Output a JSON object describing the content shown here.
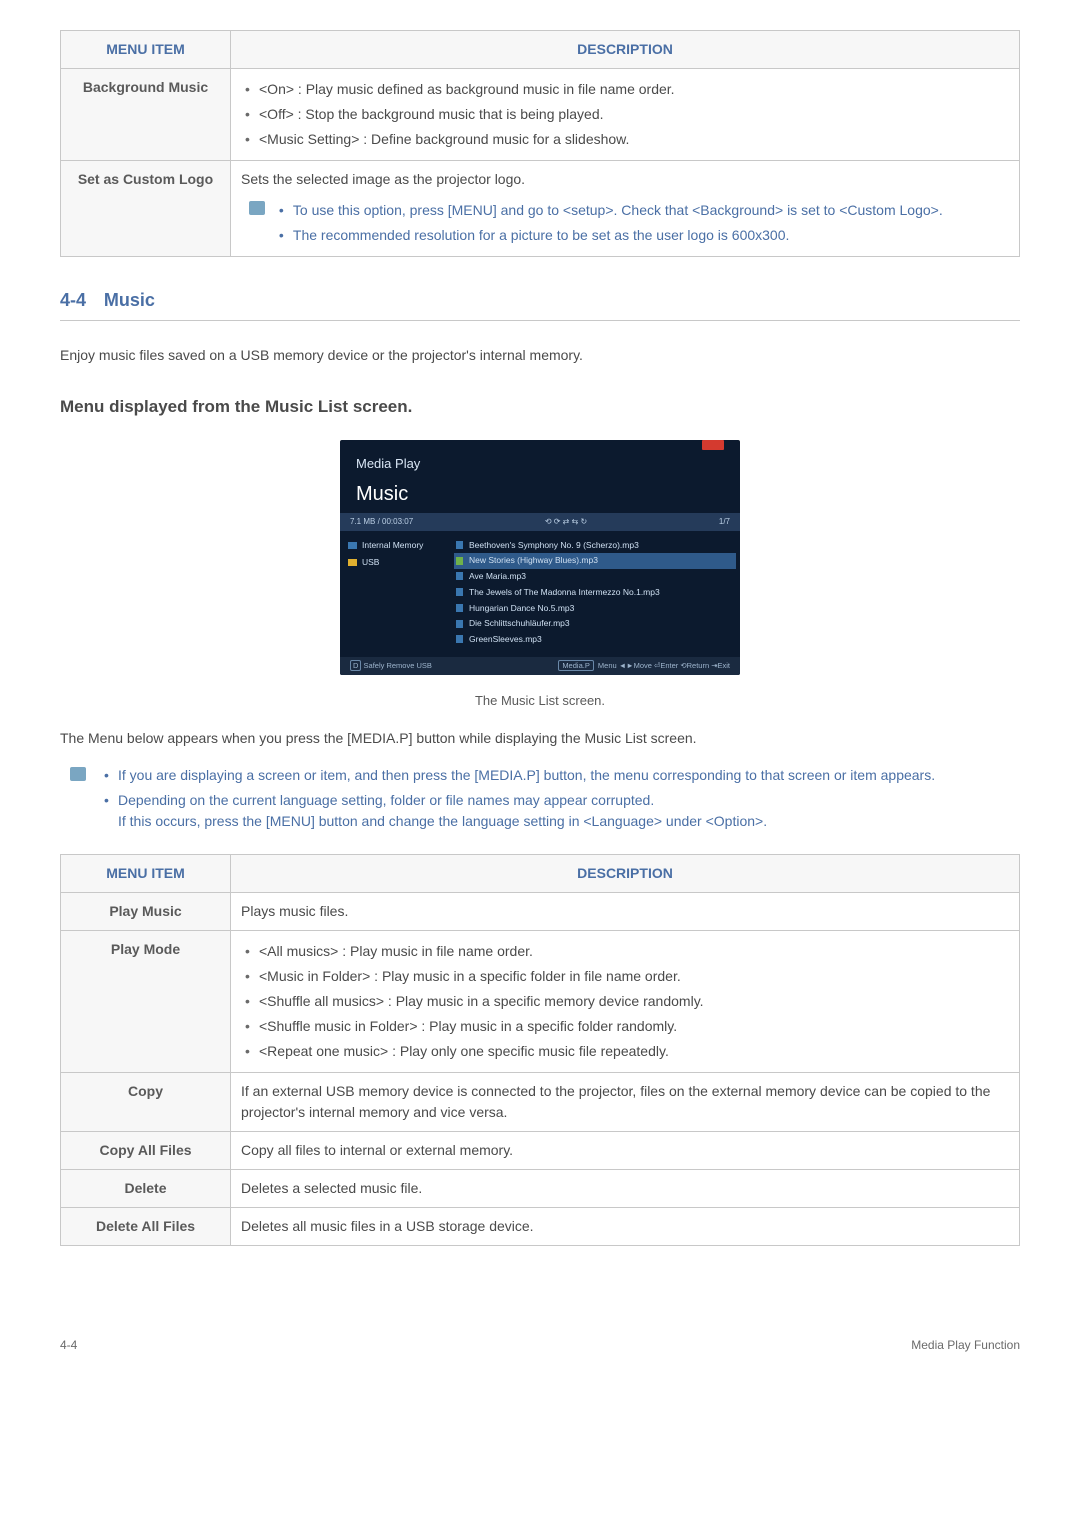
{
  "table1": {
    "headers": {
      "col1": "MENU ITEM",
      "col2": "DESCRIPTION"
    },
    "rows": [
      {
        "label": "Background Music",
        "items": [
          "<On> : Play music defined as background music in file name order.",
          "<Off> : Stop the background music that is being played.",
          "<Music Setting> : Define background music for a slideshow."
        ]
      },
      {
        "label": "Set as Custom Logo",
        "lead": "Sets the selected image as the projector logo.",
        "notes": [
          "To use this option, press [MENU] and go to <setup>. Check that <Background> is set to <Custom Logo>.",
          "The recommended resolution for a picture to be set as the user logo is 600x300."
        ]
      }
    ]
  },
  "section": {
    "num": "4-4",
    "title": "Music"
  },
  "intro": "Enjoy music files saved on a USB memory device or the projector's internal memory.",
  "subhead": "Menu displayed from the Music List screen.",
  "media": {
    "brand": "Media Play",
    "mode": "Music",
    "status_left": "7.1 MB / 00:03:07",
    "status_right": "1/7",
    "devices": [
      "Internal Memory",
      "USB"
    ],
    "tracks": [
      "Beethoven's Symphony No. 9 (Scherzo).mp3",
      "New Stories (Highway Blues).mp3",
      "Ave Maria.mp3",
      "The Jewels of The Madonna Intermezzo No.1.mp3",
      "Hungarian Dance No.5.mp3",
      "Die Schlittschuhläufer.mp3",
      "GreenSleeves.mp3"
    ],
    "foot_left": "Safely Remove USB",
    "foot_btn": "Media.P",
    "foot_right": "Menu  ◄►Move  ⏎Enter  ⟲Return  ⇥Exit"
  },
  "caption": "The Music List screen.",
  "after_fig": "The Menu below appears when you press the [MEDIA.P] button while displaying the Music List screen.",
  "notes2": [
    "If you are displaying a screen or item, and then press the [MEDIA.P] button, the menu corresponding to that screen or item appears.",
    "Depending on the current language setting, folder or file names may appear corrupted.\nIf this occurs, press the [MENU] button and change the language setting in <Language> under <Option>."
  ],
  "table2": {
    "headers": {
      "col1": "MENU ITEM",
      "col2": "DESCRIPTION"
    },
    "rows": [
      {
        "label": "Play Music",
        "text": "Plays music files."
      },
      {
        "label": "Play Mode",
        "items": [
          "<All musics> : Play music in file name order.",
          "<Music in Folder> : Play music in a specific folder in file name order.",
          "<Shuffle all musics> : Play music in a specific memory device randomly.",
          "<Shuffle music in Folder> : Play music in a specific folder randomly.",
          "<Repeat one music> : Play only one specific music file repeatedly."
        ]
      },
      {
        "label": "Copy",
        "text": "If an external USB memory device is connected to the projector, files on the external memory device can be copied to the projector's internal memory and vice versa."
      },
      {
        "label": "Copy All Files",
        "text": "Copy all files to internal or external memory."
      },
      {
        "label": "Delete",
        "text": "Deletes a selected music file."
      },
      {
        "label": "Delete All Files",
        "text": "Deletes all music files in a USB storage device."
      }
    ]
  },
  "footer": {
    "left": "4-4",
    "right": "Media Play Function"
  }
}
